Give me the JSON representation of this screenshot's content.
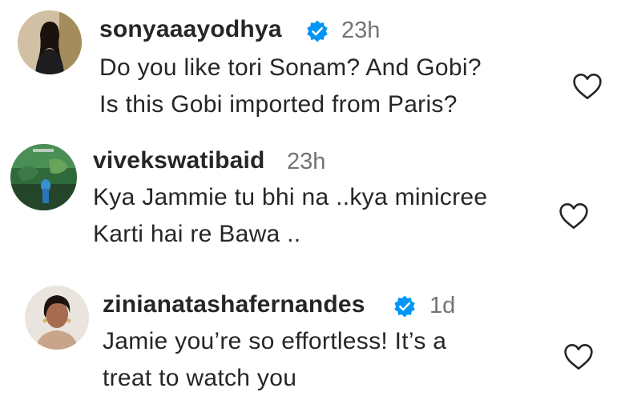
{
  "comments": [
    {
      "username": "sonyaaayodhya",
      "verified": true,
      "time": "23h",
      "lines": [
        "Do you like tori Sonam? And Gobi?",
        "Is this Gobi imported from Paris?"
      ],
      "avatar_icon": "user-avatar-photo"
    },
    {
      "username": "vivekswatibaid",
      "verified": false,
      "time": "23h",
      "lines": [
        "Kya Jammie tu bhi na ..kya minicree",
        "Karti hai re Bawa .."
      ],
      "avatar_icon": "user-avatar-photo"
    },
    {
      "username": "zinianatashafernandes",
      "verified": true,
      "time": "1d",
      "lines": [
        "Jamie you’re so effortless! It’s a",
        "treat to watch you"
      ],
      "avatar_icon": "user-avatar-photo"
    }
  ],
  "colors": {
    "text": "#262626",
    "muted": "#737373",
    "verified_blue": "#0095f6"
  }
}
